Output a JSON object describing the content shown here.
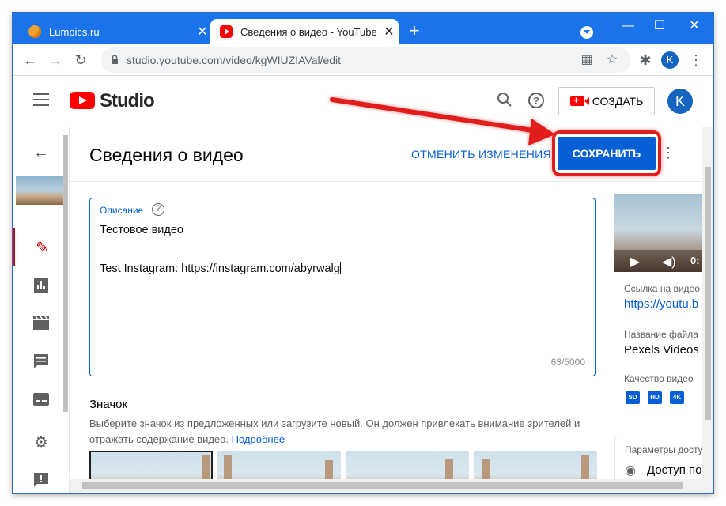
{
  "browser": {
    "tabs": [
      {
        "title": "Lumpics.ru",
        "close": "✕"
      },
      {
        "title": "Сведения о видео - YouTube Studio",
        "close": "✕"
      }
    ],
    "new_tab": "+",
    "window_controls": {
      "minimize": "—",
      "maximize": "☐",
      "close": "✕"
    },
    "url": "studio.youtube.com/video/kgWIUZIAVal/edit",
    "profile_initial": "K"
  },
  "header": {
    "logo_text": "Studio",
    "create_label": "СОЗДАТЬ",
    "avatar_initial": "K"
  },
  "page": {
    "title": "Сведения о видео",
    "undo_label": "ОТМЕНИТЬ ИЗМЕНЕНИЯ",
    "save_label": "СОХРАНИТЬ"
  },
  "description": {
    "label": "Описание",
    "help": "?",
    "line1": "Тестовое видео",
    "line2": "Test Instagram: https://instagram.com/abyrwalg",
    "counter": "63/5000"
  },
  "thumbnail": {
    "title": "Значок",
    "text": "Выберите значок из предложенных или загрузите новый. Он должен привлекать внимание зрителей и отражать содержание видео.",
    "link": "Подробнее"
  },
  "right_panel": {
    "time": "0:",
    "link_label": "Ссылка на видео",
    "link_value": "https://youtu.b",
    "filename_label": "Название файла",
    "filename_value": "Pexels Videos",
    "quality_label": "Качество видео",
    "quality_badges": [
      "SD",
      "HD",
      "4K"
    ],
    "params_label": "Параметры доступа",
    "access_value": "Доступ по"
  },
  "colors": {
    "accent": "#065fd4",
    "browser_blue": "#1a73e8",
    "highlight_red": "#e01e1e",
    "yt_red": "#ff0000"
  }
}
